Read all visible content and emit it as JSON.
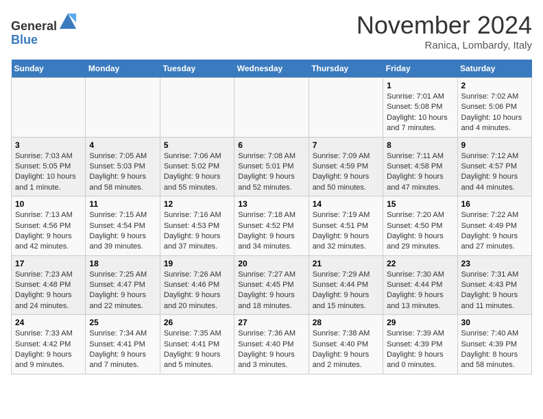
{
  "header": {
    "logo_line1": "General",
    "logo_line2": "Blue",
    "month_title": "November 2024",
    "location": "Ranica, Lombardy, Italy"
  },
  "days_of_week": [
    "Sunday",
    "Monday",
    "Tuesday",
    "Wednesday",
    "Thursday",
    "Friday",
    "Saturday"
  ],
  "weeks": [
    [
      {
        "day": "",
        "info": ""
      },
      {
        "day": "",
        "info": ""
      },
      {
        "day": "",
        "info": ""
      },
      {
        "day": "",
        "info": ""
      },
      {
        "day": "",
        "info": ""
      },
      {
        "day": "1",
        "info": "Sunrise: 7:01 AM\nSunset: 5:08 PM\nDaylight: 10 hours and 7 minutes."
      },
      {
        "day": "2",
        "info": "Sunrise: 7:02 AM\nSunset: 5:06 PM\nDaylight: 10 hours and 4 minutes."
      }
    ],
    [
      {
        "day": "3",
        "info": "Sunrise: 7:03 AM\nSunset: 5:05 PM\nDaylight: 10 hours and 1 minute."
      },
      {
        "day": "4",
        "info": "Sunrise: 7:05 AM\nSunset: 5:03 PM\nDaylight: 9 hours and 58 minutes."
      },
      {
        "day": "5",
        "info": "Sunrise: 7:06 AM\nSunset: 5:02 PM\nDaylight: 9 hours and 55 minutes."
      },
      {
        "day": "6",
        "info": "Sunrise: 7:08 AM\nSunset: 5:01 PM\nDaylight: 9 hours and 52 minutes."
      },
      {
        "day": "7",
        "info": "Sunrise: 7:09 AM\nSunset: 4:59 PM\nDaylight: 9 hours and 50 minutes."
      },
      {
        "day": "8",
        "info": "Sunrise: 7:11 AM\nSunset: 4:58 PM\nDaylight: 9 hours and 47 minutes."
      },
      {
        "day": "9",
        "info": "Sunrise: 7:12 AM\nSunset: 4:57 PM\nDaylight: 9 hours and 44 minutes."
      }
    ],
    [
      {
        "day": "10",
        "info": "Sunrise: 7:13 AM\nSunset: 4:56 PM\nDaylight: 9 hours and 42 minutes."
      },
      {
        "day": "11",
        "info": "Sunrise: 7:15 AM\nSunset: 4:54 PM\nDaylight: 9 hours and 39 minutes."
      },
      {
        "day": "12",
        "info": "Sunrise: 7:16 AM\nSunset: 4:53 PM\nDaylight: 9 hours and 37 minutes."
      },
      {
        "day": "13",
        "info": "Sunrise: 7:18 AM\nSunset: 4:52 PM\nDaylight: 9 hours and 34 minutes."
      },
      {
        "day": "14",
        "info": "Sunrise: 7:19 AM\nSunset: 4:51 PM\nDaylight: 9 hours and 32 minutes."
      },
      {
        "day": "15",
        "info": "Sunrise: 7:20 AM\nSunset: 4:50 PM\nDaylight: 9 hours and 29 minutes."
      },
      {
        "day": "16",
        "info": "Sunrise: 7:22 AM\nSunset: 4:49 PM\nDaylight: 9 hours and 27 minutes."
      }
    ],
    [
      {
        "day": "17",
        "info": "Sunrise: 7:23 AM\nSunset: 4:48 PM\nDaylight: 9 hours and 24 minutes."
      },
      {
        "day": "18",
        "info": "Sunrise: 7:25 AM\nSunset: 4:47 PM\nDaylight: 9 hours and 22 minutes."
      },
      {
        "day": "19",
        "info": "Sunrise: 7:26 AM\nSunset: 4:46 PM\nDaylight: 9 hours and 20 minutes."
      },
      {
        "day": "20",
        "info": "Sunrise: 7:27 AM\nSunset: 4:45 PM\nDaylight: 9 hours and 18 minutes."
      },
      {
        "day": "21",
        "info": "Sunrise: 7:29 AM\nSunset: 4:44 PM\nDaylight: 9 hours and 15 minutes."
      },
      {
        "day": "22",
        "info": "Sunrise: 7:30 AM\nSunset: 4:44 PM\nDaylight: 9 hours and 13 minutes."
      },
      {
        "day": "23",
        "info": "Sunrise: 7:31 AM\nSunset: 4:43 PM\nDaylight: 9 hours and 11 minutes."
      }
    ],
    [
      {
        "day": "24",
        "info": "Sunrise: 7:33 AM\nSunset: 4:42 PM\nDaylight: 9 hours and 9 minutes."
      },
      {
        "day": "25",
        "info": "Sunrise: 7:34 AM\nSunset: 4:41 PM\nDaylight: 9 hours and 7 minutes."
      },
      {
        "day": "26",
        "info": "Sunrise: 7:35 AM\nSunset: 4:41 PM\nDaylight: 9 hours and 5 minutes."
      },
      {
        "day": "27",
        "info": "Sunrise: 7:36 AM\nSunset: 4:40 PM\nDaylight: 9 hours and 3 minutes."
      },
      {
        "day": "28",
        "info": "Sunrise: 7:38 AM\nSunset: 4:40 PM\nDaylight: 9 hours and 2 minutes."
      },
      {
        "day": "29",
        "info": "Sunrise: 7:39 AM\nSunset: 4:39 PM\nDaylight: 9 hours and 0 minutes."
      },
      {
        "day": "30",
        "info": "Sunrise: 7:40 AM\nSunset: 4:39 PM\nDaylight: 8 hours and 58 minutes."
      }
    ]
  ]
}
